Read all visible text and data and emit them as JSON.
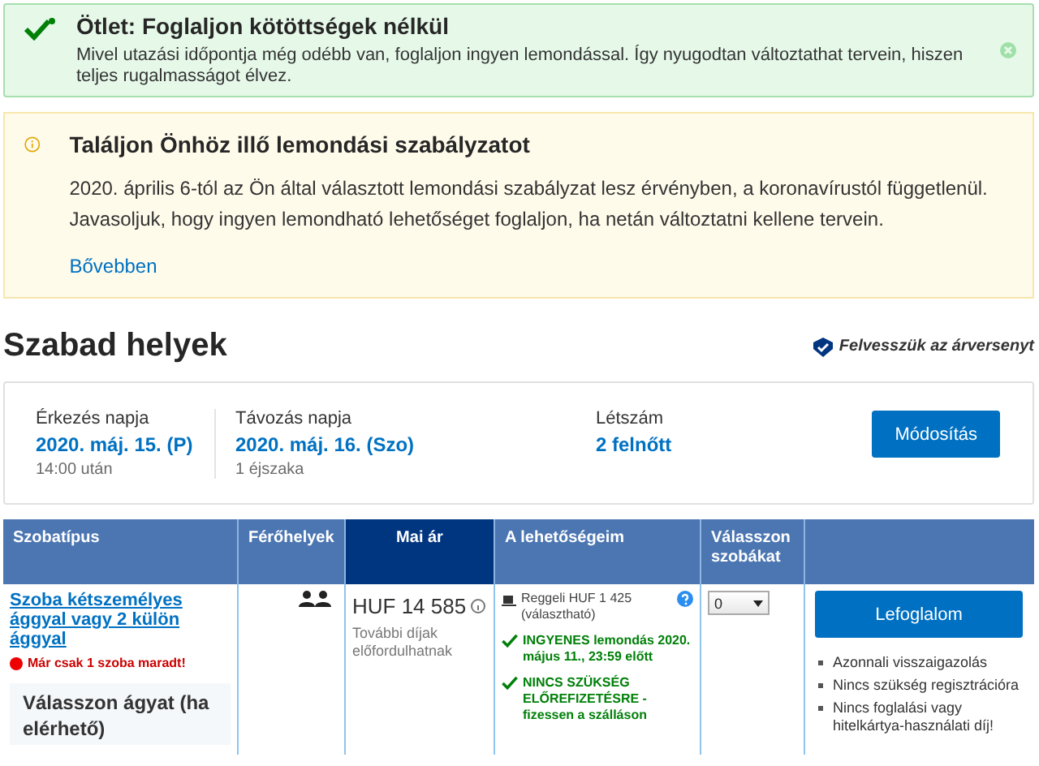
{
  "tip": {
    "title": "Ötlet: Foglaljon kötöttségek nélkül",
    "text": "Mivel utazási időpontja még odébb van, foglaljon ingyen lemondással. Így nyugodtan változtathat tervein, hiszen teljes rugalmasságot élvez."
  },
  "notice": {
    "title": "Találjon Önhöz illő lemondási szabályzatot",
    "text": "2020. április 6-tól az Ön által választott lemondási szabályzat lesz érvényben, a koronavírustól függetlenül. Javasoljuk, hogy ingyen lemondható lehetőséget foglaljon, ha netán változtatni kellene tervein.",
    "link": "Bővebben"
  },
  "section": {
    "title": "Szabad helyek",
    "badge": "Felvesszük az árversenyt"
  },
  "search": {
    "fields": [
      {
        "label": "Érkezés napja",
        "value": "2020. máj. 15. (P)",
        "note": "14:00 után"
      },
      {
        "label": "Távozás napja",
        "value": "2020. máj. 16. (Szo)",
        "note": "1 éjszaka"
      },
      {
        "label": "Létszám",
        "value": "2 felnőtt"
      }
    ],
    "button": "Módosítás"
  },
  "table": {
    "columns": [
      {
        "label": "Szobatípus",
        "selected": false
      },
      {
        "label": "Férőhelyek",
        "selected": false
      },
      {
        "label": "Mai ár",
        "selected": true
      },
      {
        "label": "A lehetőségeim",
        "selected": false
      },
      {
        "label": "Válasszon szobákat",
        "selected": false
      }
    ],
    "rows": [
      {
        "room": "Szoba kétszemélyes ággyal vagy 2 külön ággyal",
        "alert": "Már csak 1 szoba maradt!",
        "bed_prompt": "Válasszon ágyat (ha elérhető)",
        "price": "HUF 14 585",
        "price_note": "További díjak előfordulhatnak",
        "options": [
          {
            "kind": "breakfast",
            "text": "Reggeli HUF 1 425 (választható)"
          },
          {
            "kind": "check",
            "text": "INGYENES lemondás 2020. május 11., 23:59 előtt"
          },
          {
            "kind": "check",
            "text": "NINCS SZÜKSÉG ELŐREFIZETÉSRE - fizessen a szálláson"
          }
        ],
        "quantity": "0",
        "book": "Lefoglalom",
        "benefits": [
          "Azonnali visszaigazolás",
          "Nincs szükség regisztrációra",
          "Nincs foglalási vagy hitelkártya-használati díj!"
        ]
      }
    ]
  }
}
